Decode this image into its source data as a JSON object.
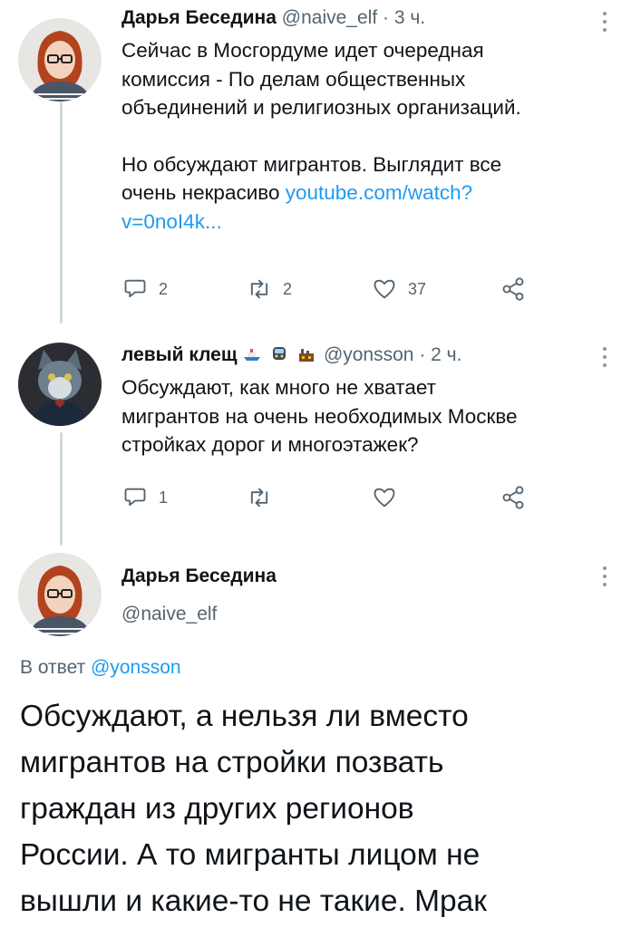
{
  "tweets": [
    {
      "name": "Дарья Беседина",
      "handle": "@naive_elf",
      "time": "· 3 ч.",
      "line1": "Сейчас в Мосгордуме идет очередная",
      "line2": "комиссия - По делам общественных",
      "line3": "объединений и религиозных организаций.",
      "line4": "Но обсуждают мигрантов. Выглядит все",
      "line5_text": "очень некрасиво ",
      "line5_link": "youtube.com/watch?",
      "line6_link": "v=0noI4k...",
      "replies": "2",
      "retweets": "2",
      "likes": "37"
    },
    {
      "name": "левый клещ",
      "handle": "@yonsson",
      "time": "· 2 ч.",
      "line1": "Обсуждают, как много не хватает",
      "line2": "мигрантов на очень необходимых Москве",
      "line3": "стройках дорог и многоэтажек?",
      "replies": "1",
      "retweets": "",
      "likes": ""
    }
  ],
  "main": {
    "name": "Дарья Беседина",
    "handle": "@naive_elf",
    "reply_prefix": "В ответ ",
    "reply_to": "@yonsson",
    "line1": "Обсуждают, а нельзя ли вместо",
    "line2": "мигрантов на стройки позвать",
    "line3": "граждан из других регионов",
    "line4": "России. А то мигранты лицом не",
    "line5": "вышли и какие-то не такие. Мрак"
  },
  "icons": [
    "reply-icon",
    "retweet-icon",
    "like-icon",
    "share-icon",
    "more-icon",
    "ship-emoji",
    "train-emoji",
    "factory-emoji"
  ],
  "colors": {
    "link": "#1d9bf0",
    "secondary": "#536471",
    "thread_line": "#cfd9de"
  }
}
